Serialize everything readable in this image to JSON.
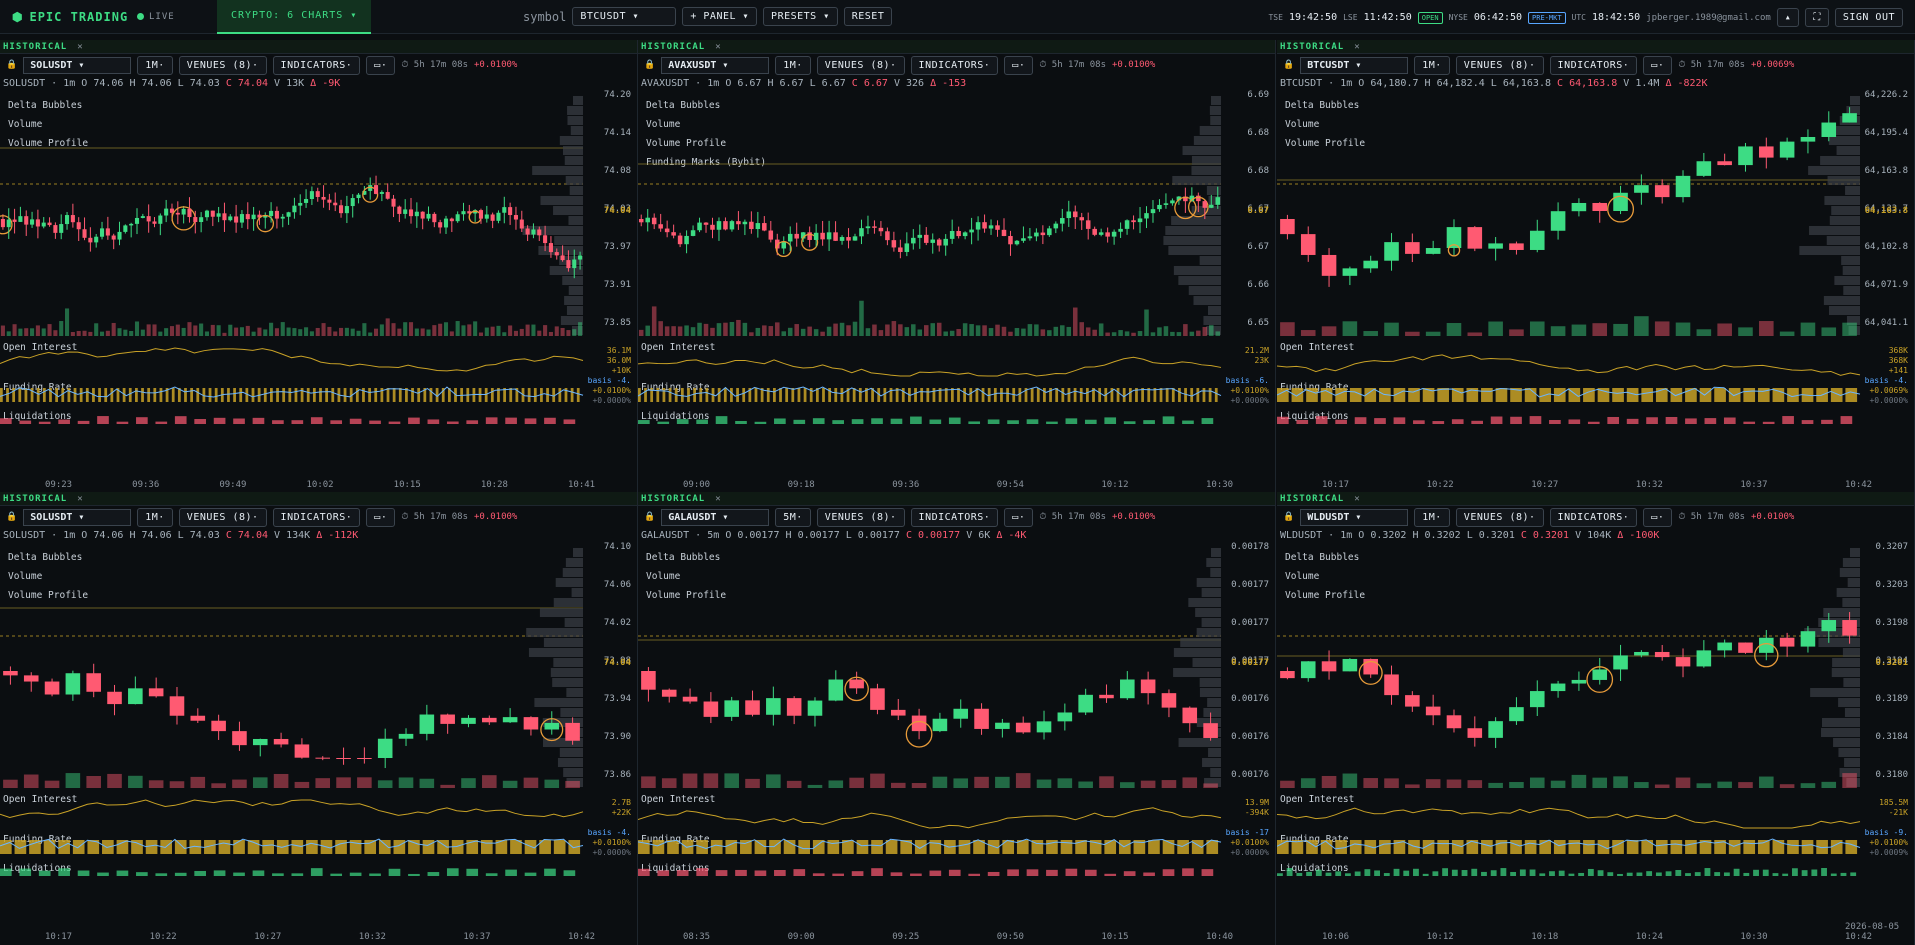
{
  "app": {
    "brand": "EPIC TRADING",
    "live": "LIVE",
    "workspace_tab": "CRYPTO: 6 CHARTS ▾",
    "symbol_label": "symbol",
    "symbol_value": "BTCUSDT",
    "panel_btn": "+ PANEL ▾",
    "presets_btn": "PRESETS ▾",
    "reset_btn": "RESET",
    "clocks": [
      {
        "label": "TSE",
        "time": "19:42:50"
      },
      {
        "label": "LSE",
        "time": "11:42:50",
        "pill": "OPEN"
      },
      {
        "label": "NYSE",
        "time": "06:42:50",
        "pill": "PRE-MKT"
      },
      {
        "label": "UTC",
        "time": "18:42:50"
      }
    ],
    "email": "jpberger.1989@gmail.com",
    "collapse": "▴",
    "fullscreen": "⛶",
    "signout": "SIGN OUT"
  },
  "colors": {
    "up": "#3ddc84",
    "down": "#ff5a72",
    "accent": "#3ddc84",
    "funding": "#c9a227"
  },
  "panels": [
    {
      "hist": "HISTORICAL",
      "sym": "SOLUSDT",
      "tf": "1M",
      "venues": "VENUES (8)",
      "ind": "INDICATORS",
      "timer": "5h 17m 08s",
      "rate": "+0.0100%",
      "ohlc": {
        "sym": "SOLUSDT · 1m",
        "o": "O 74.06",
        "h": "H 74.06",
        "l": "L 74.03",
        "c": "C 74.04",
        "v": "V 13K",
        "d": "Δ -9K"
      },
      "legend": [
        "Delta Bubbles",
        "Volume",
        "Volume Profile"
      ],
      "prices": [
        "74.20",
        "74.14",
        "74.08",
        "74.03",
        "73.97",
        "73.91",
        "73.85"
      ],
      "last": "74.04",
      "oi": [
        "36.1M",
        "36.0M",
        "+10K"
      ],
      "fr": [
        "basis -4.",
        "+0.0100%",
        "+0.0000%"
      ],
      "times": [
        "09:23",
        "09:36",
        "09:49",
        "10:02",
        "10:15",
        "10:28",
        "10:41"
      ],
      "seed": 3,
      "trend": -0.2
    },
    {
      "hist": "HISTORICAL",
      "sym": "AVAXUSDT",
      "tf": "1M",
      "venues": "VENUES (8)",
      "ind": "INDICATORS",
      "timer": "5h 17m 08s",
      "rate": "+0.0100%",
      "ohlc": {
        "sym": "AVAXUSDT · 1m",
        "o": "O 6.67",
        "h": "H 6.67",
        "l": "L 6.67",
        "c": "C 6.67",
        "v": "V 326",
        "d": "Δ -153"
      },
      "legend": [
        "Delta Bubbles",
        "Volume",
        "Volume Profile",
        "Funding Marks (Bybit)"
      ],
      "prices": [
        "6.69",
        "6.68",
        "6.68",
        "6.67",
        "6.67",
        "6.66",
        "6.65"
      ],
      "last": "6.67",
      "oi": [
        "21.2M",
        "23K"
      ],
      "fr": [
        "basis -6.",
        "+0.0100%",
        "+0.0000%"
      ],
      "times": [
        "09:00",
        "09:18",
        "09:36",
        "09:54",
        "10:12",
        "10:30"
      ],
      "seed": 7,
      "trend": 0
    },
    {
      "hist": "HISTORICAL",
      "sym": "BTCUSDT",
      "tf": "1M",
      "venues": "VENUES (8)",
      "ind": "INDICATORS",
      "timer": "5h 17m 08s",
      "rate": "+0.0069%",
      "ohlc": {
        "sym": "BTCUSDT · 1m",
        "o": "O 64,180.7",
        "h": "H 64,182.4",
        "l": "L 64,163.8",
        "c": "C 64,163.8",
        "v": "V 1.4M",
        "d": "Δ -822K"
      },
      "legend": [
        "Delta Bubbles",
        "Volume",
        "Volume Profile"
      ],
      "prices": [
        "64,226.2",
        "64,195.4",
        "64,163.8",
        "64,133.7",
        "64,102.8",
        "64,071.9",
        "64,041.1"
      ],
      "last": "64,163.8",
      "oi": [
        "368K",
        "368K",
        "+141"
      ],
      "fr": [
        "basis -4.",
        "+0.0069%",
        "+0.0000%"
      ],
      "times": [
        "10:17",
        "10:22",
        "10:27",
        "10:32",
        "10:37",
        "10:42"
      ],
      "seed": 11,
      "trend": 0.6
    },
    {
      "hist": "HISTORICAL",
      "sym": "SOLUSDT",
      "tf": "1M",
      "venues": "VENUES (8)",
      "ind": "INDICATORS",
      "timer": "5h 17m 08s",
      "rate": "+0.0100%",
      "ohlc": {
        "sym": "SOLUSDT · 1m",
        "o": "O 74.06",
        "h": "H 74.06",
        "l": "L 74.03",
        "c": "C 74.04",
        "v": "V 134K",
        "d": "Δ -112K"
      },
      "legend": [
        "Delta Bubbles",
        "Volume",
        "Volume Profile"
      ],
      "prices": [
        "74.10",
        "74.06",
        "74.02",
        "73.98",
        "73.94",
        "73.90",
        "73.86"
      ],
      "last": "74.04",
      "oi": [
        "2.7B",
        "+22K"
      ],
      "fr": [
        "basis -4.",
        "+0.0100%",
        "+0.0000%"
      ],
      "times": [
        "10:17",
        "10:22",
        "10:27",
        "10:32",
        "10:37",
        "10:42"
      ],
      "seed": 5,
      "trend": 0.5
    },
    {
      "hist": "HISTORICAL",
      "sym": "GALAUSDT",
      "tf": "5M",
      "venues": "VENUES (8)",
      "ind": "INDICATORS",
      "timer": "5h 17m 08s",
      "rate": "+0.0100%",
      "ohlc": {
        "sym": "GALAUSDT · 5m",
        "o": "O 0.00177",
        "h": "H 0.00177",
        "l": "L 0.00177",
        "c": "C 0.00177",
        "v": "V 6K",
        "d": "Δ -4K"
      },
      "legend": [
        "Delta Bubbles",
        "Volume",
        "Volume Profile"
      ],
      "prices": [
        "0.00178",
        "0.00177",
        "0.00177",
        "0.00177",
        "0.00176",
        "0.00176",
        "0.00176"
      ],
      "last": "0.00177",
      "oi": [
        "13.9M",
        "-394K"
      ],
      "fr": [
        "basis -17",
        "+0.0100%",
        "+0.0000%"
      ],
      "times": [
        "08:35",
        "09:00",
        "09:25",
        "09:50",
        "10:15",
        "10:40"
      ],
      "seed": 13,
      "trend": -0.3
    },
    {
      "hist": "HISTORICAL",
      "sym": "WLDUSDT",
      "tf": "1M",
      "venues": "VENUES (8)",
      "ind": "INDICATORS",
      "timer": "5h 17m 08s",
      "rate": "+0.0100%",
      "ohlc": {
        "sym": "WLDUSDT · 1m",
        "o": "O 0.3202",
        "h": "H 0.3202",
        "l": "L 0.3201",
        "c": "C 0.3201",
        "v": "V 104K",
        "d": "Δ -100K"
      },
      "legend": [
        "Delta Bubbles",
        "Volume",
        "Volume Profile"
      ],
      "prices": [
        "0.3207",
        "0.3203",
        "0.3198",
        "0.3194",
        "0.3189",
        "0.3184",
        "0.3180"
      ],
      "last": "0.3201",
      "oi": [
        "185.5M",
        "-21K"
      ],
      "fr": [
        "basis -9.",
        "+0.0100%",
        "+0.0009%"
      ],
      "times": [
        "10:06",
        "10:12",
        "10:18",
        "10:24",
        "10:30",
        "2026-08-05 10:42"
      ],
      "seed": 17,
      "trend": 0.4
    }
  ],
  "sub_labels": {
    "oi": "Open Interest",
    "fr": "Funding Rate",
    "liq": "Liquidations"
  }
}
